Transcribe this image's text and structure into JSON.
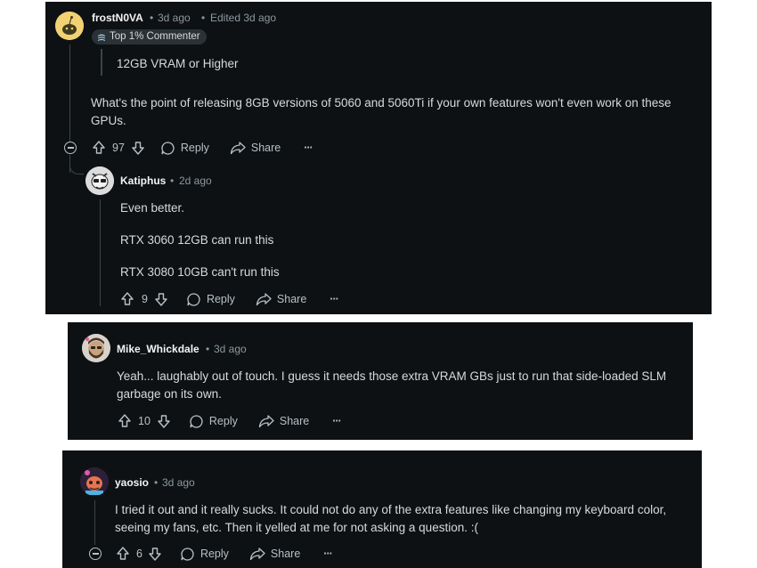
{
  "comments": [
    {
      "username": "frostN0VA",
      "age": "3d ago",
      "edited": "Edited 3d ago",
      "badge": "Top 1% Commenter",
      "quote": "12GB VRAM or Higher",
      "body": "What's the point of releasing 8GB versions of 5060 and 5060Ti if your own features won't even work on these GPUs.",
      "votes": "97",
      "reply_label": "Reply",
      "share_label": "Share"
    },
    {
      "username": "Katiphus",
      "age": "2d ago",
      "paragraphs": [
        "Even better.",
        "RTX 3060 12GB can run this",
        "RTX 3080 10GB can't run this"
      ],
      "votes": "9",
      "reply_label": "Reply",
      "share_label": "Share"
    },
    {
      "username": "Mike_Whickdale",
      "age": "3d ago",
      "body": "Yeah... laughably out of touch. I guess it needs those extra VRAM GBs just to run that side-loaded SLM garbage on its own.",
      "votes": "10",
      "reply_label": "Reply",
      "share_label": "Share"
    },
    {
      "username": "yaosio",
      "age": "3d ago",
      "body": "I tried it out and it really sucks. It could not do any of the extra features like changing my keyboard color, seeing my fans, etc. Then it yelled at me for not asking a question. :(",
      "votes": "6",
      "reply_label": "Reply",
      "share_label": "Share"
    }
  ],
  "separator": "•",
  "more_glyph": "···",
  "colors": {
    "background": "#0e1113",
    "text": "#d7dadc",
    "muted": "#8b989e",
    "badge_bg": "#2a3236"
  },
  "icons": [
    "upvote-icon",
    "downvote-icon",
    "comment-icon",
    "share-icon",
    "more-icon",
    "collapse-icon",
    "badge-icon",
    "avatar"
  ]
}
